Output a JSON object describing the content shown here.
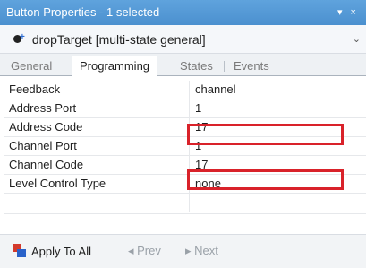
{
  "window": {
    "title": "Button Properties - 1 selected",
    "controls": "▾ ×"
  },
  "selector": {
    "object": "dropTarget  [multi-state general]",
    "chevron": "⌄"
  },
  "tabs": [
    {
      "label": "General"
    },
    {
      "label": "Programming"
    },
    {
      "label": "States"
    },
    {
      "label": "Events"
    }
  ],
  "properties": [
    {
      "name": "Feedback",
      "value": "channel"
    },
    {
      "name": "Address Port",
      "value": "1"
    },
    {
      "name": "Address Code",
      "value": "17"
    },
    {
      "name": "Channel Port",
      "value": "1"
    },
    {
      "name": "Channel Code",
      "value": "17"
    },
    {
      "name": "Level Control Type",
      "value": "none"
    }
  ],
  "footer": {
    "apply_label": "Apply To All",
    "prev_label": "◂  Prev",
    "next_label": "▸  Next"
  },
  "colors": {
    "titlebar": "#4b90cf",
    "highlight": "#d9222a"
  }
}
